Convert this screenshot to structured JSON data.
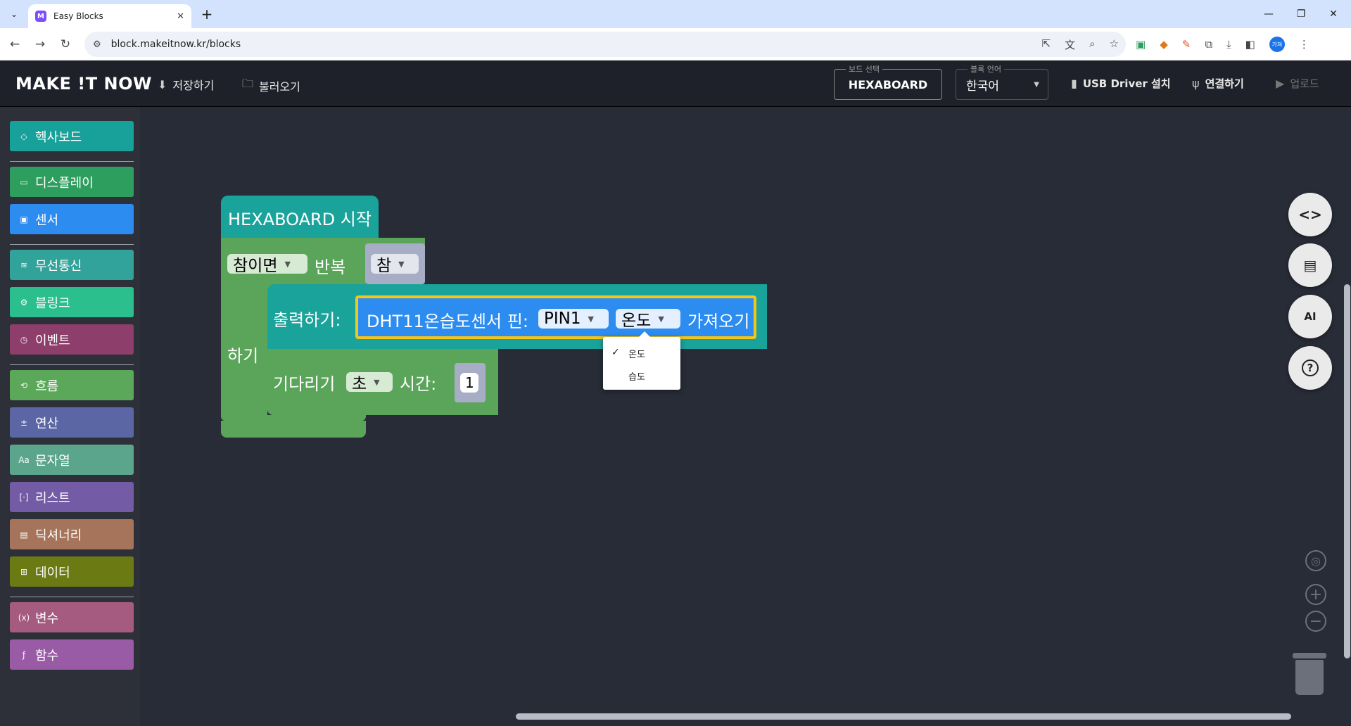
{
  "browser": {
    "tab_title": "Easy Blocks",
    "tab_favicon": "M",
    "url": "block.makeitnow.kr/blocks",
    "profile_label": "가져"
  },
  "header": {
    "logo": "MAKE !T NOW",
    "save_label": "저장하기",
    "load_label": "불러오기",
    "board_legend": "보드 선택",
    "board_value": "HEXABOARD",
    "lang_legend": "블록 언어",
    "lang_value": "한국어",
    "usb_label": "USB Driver 설치",
    "connect_label": "연결하기",
    "upload_label": "업로드"
  },
  "sidebar": {
    "categories": [
      {
        "label": "헥사보드",
        "color": "#18a09a",
        "icon": "diamond-icon"
      },
      {
        "label": "디스플레이",
        "color": "#2e9e5e",
        "icon": "display-icon"
      },
      {
        "label": "센서",
        "color": "#2d8cf0",
        "icon": "sensor-icon"
      },
      {
        "label": "무선통신",
        "color": "#32a39a",
        "icon": "wifi-icon"
      },
      {
        "label": "블링크",
        "color": "#2bbf8e",
        "icon": "iot-icon"
      },
      {
        "label": "이벤트",
        "color": "#8e3e6a",
        "icon": "clock-icon"
      },
      {
        "label": "흐름",
        "color": "#5ba85b",
        "icon": "loop-icon"
      },
      {
        "label": "연산",
        "color": "#5b67a5",
        "icon": "math-icon"
      },
      {
        "label": "문자열",
        "color": "#5ba58c",
        "icon": "text-icon"
      },
      {
        "label": "리스트",
        "color": "#745ba5",
        "icon": "list-icon"
      },
      {
        "label": "딕셔너리",
        "color": "#a5745b",
        "icon": "dictionary-icon"
      },
      {
        "label": "데이터",
        "color": "#6b7a12",
        "icon": "data-icon"
      },
      {
        "label": "변수",
        "color": "#a55b80",
        "icon": "variable-icon"
      },
      {
        "label": "함수",
        "color": "#995ba5",
        "icon": "function-icon"
      }
    ]
  },
  "blocks": {
    "start_label": "HEXABOARD 시작",
    "repeat_mode": "참이면",
    "repeat_label": "반복",
    "repeat_condition": "참",
    "do_label": "하기",
    "print_label": "출력하기:",
    "sensor_label": "DHT11온습도센서 핀:",
    "pin_value": "PIN1",
    "measure_value": "온도",
    "get_label": "가져오기",
    "wait_label": "기다리기",
    "wait_unit": "초",
    "time_label": "시간:",
    "time_value": "1"
  },
  "dropdown_menu": {
    "items": [
      "온도",
      "습도"
    ],
    "selected": "온도",
    "check": "✓"
  },
  "fabs": {
    "code": "<>",
    "ai": "AI",
    "help": "?"
  },
  "colors": {
    "teal_block": "#1aa39a",
    "green_block": "#5ba55b",
    "blue_block": "#2d8cf0",
    "highlight": "#f5c518"
  }
}
